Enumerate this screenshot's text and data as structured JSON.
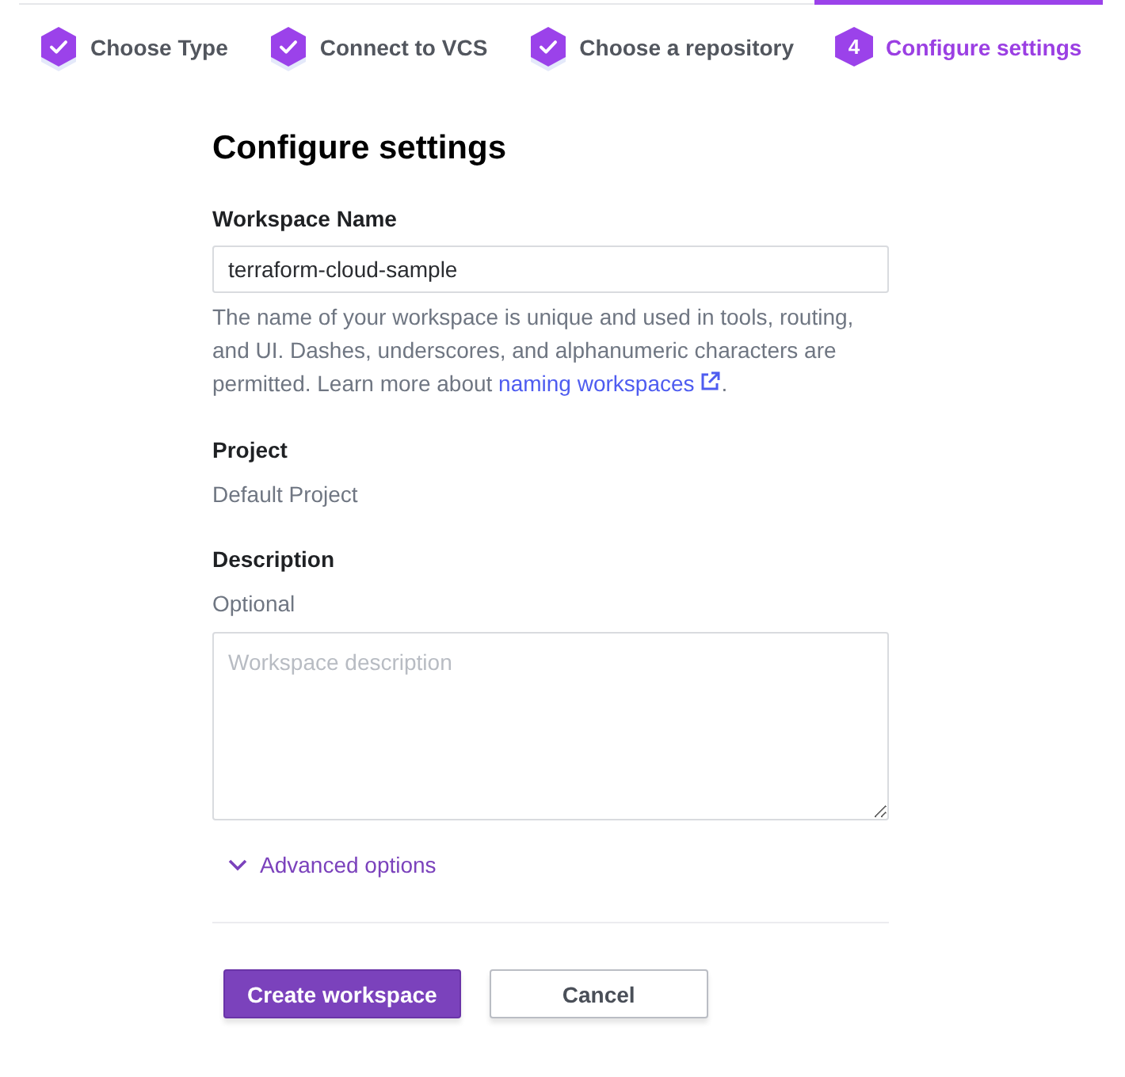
{
  "steps": [
    {
      "label": "Choose Type",
      "completed": true,
      "selected": false
    },
    {
      "label": "Connect to VCS",
      "completed": true,
      "selected": false
    },
    {
      "label": "Choose a repository",
      "completed": true,
      "selected": false
    },
    {
      "label": "Configure settings",
      "number": "4",
      "completed": false,
      "selected": true
    }
  ],
  "form": {
    "title": "Configure settings",
    "fields": [
      {
        "kind": "text",
        "label": "Workspace Name",
        "value": "terraform-cloud-sample",
        "help": {
          "text": "The name of your workspace is unique and used in tools, routing, and UI. Dashes, underscores, and alphanumeric characters are permitted. Learn more about ",
          "link": "naming workspaces",
          "end": "."
        }
      },
      {
        "kind": "static",
        "label": "Project",
        "value": "Default Project"
      },
      {
        "kind": "textarea",
        "label": "Description",
        "hint": "Optional",
        "placeholder": "Workspace description"
      }
    ]
  },
  "advanced": {
    "label": "Advanced options",
    "expanded": false
  },
  "buttons": [
    {
      "label": "Create workspace",
      "kind": "primary"
    },
    {
      "label": "Cancel",
      "kind": "secondary"
    }
  ]
}
